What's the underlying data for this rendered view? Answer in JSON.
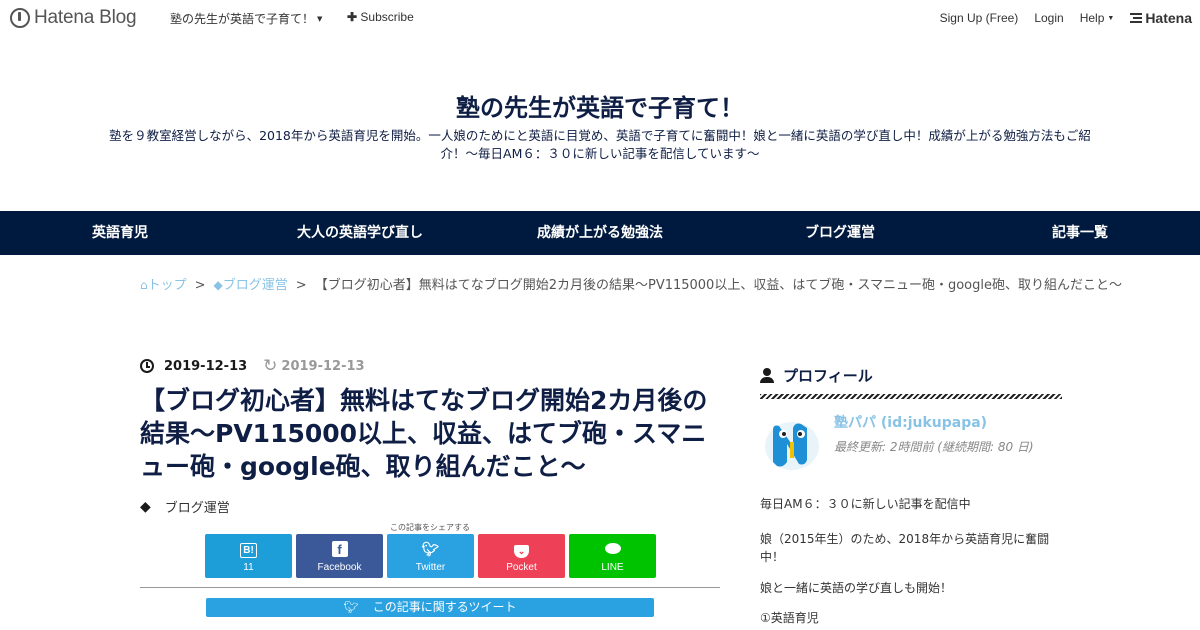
{
  "header": {
    "logo_text": "Hatena Blog",
    "blog_selector": "塾の先生が英語で子育て！",
    "subscribe": "Subscribe",
    "signup": "Sign Up (Free)",
    "login": "Login",
    "help": "Help",
    "hatena": "Hatena"
  },
  "blog": {
    "title": "塾の先生が英語で子育て！",
    "description": "塾を９教室経営しながら、2018年から英語育児を開始。一人娘のためにと英語に目覚め、英語で子育てに奮闘中！娘と一緒に英語の学び直し中！成績が上がる勉強方法もご紹介！～毎日AM６：３０に新しい記事を配信しています～"
  },
  "nav": {
    "items": [
      {
        "label": "英語育児"
      },
      {
        "label": "大人の英語学び直し"
      },
      {
        "label": "成績が上がる勉強法"
      },
      {
        "label": "ブログ運営"
      },
      {
        "label": "記事一覧"
      }
    ]
  },
  "breadcrumb": {
    "top": "トップ",
    "sep": ">",
    "category": "ブログ運営",
    "current": "【ブログ初心者】無料はてなブログ開始2カ月後の結果～PV115000以上、収益、はてブ砲・スマニュー砲・google砲、取り組んだこと～"
  },
  "article": {
    "published": "2019-12-13",
    "updated": "2019-12-13",
    "title": "【ブログ初心者】無料はてなブログ開始2カ月後の結果～PV115000以上、収益、はてブ砲・スマニュー砲・google砲、取り組んだこと～",
    "category": "ブログ運営"
  },
  "share": {
    "caption": "この記事をシェアする",
    "hatebu_icon": "B!",
    "hatebu_count": "11",
    "facebook": "Facebook",
    "twitter": "Twitter",
    "pocket": "Pocket",
    "line": "LINE",
    "tweet_bar": "この記事に関するツイート"
  },
  "sidebar": {
    "heading": "プロフィール",
    "name": "塾パパ (id:jukupapa)",
    "last_updated": "最終更新: 2時間前 (継続期間: 80 日)",
    "lines": [
      "毎日AM６：３０に新しい記事を配信中",
      "娘（2015年生）のため、2018年から英語育児に奮闘中！",
      "娘と一緒に英語の学び直しも開始！",
      "①英語育児"
    ]
  },
  "colors": {
    "nav_bg": "#001a3f",
    "title_color": "#0f1e45",
    "link_color": "#88c3e6",
    "hatebu": "#1e9ed8",
    "facebook": "#3b5998",
    "twitter": "#2aa1e1",
    "pocket": "#ee4056",
    "line": "#00c300"
  }
}
